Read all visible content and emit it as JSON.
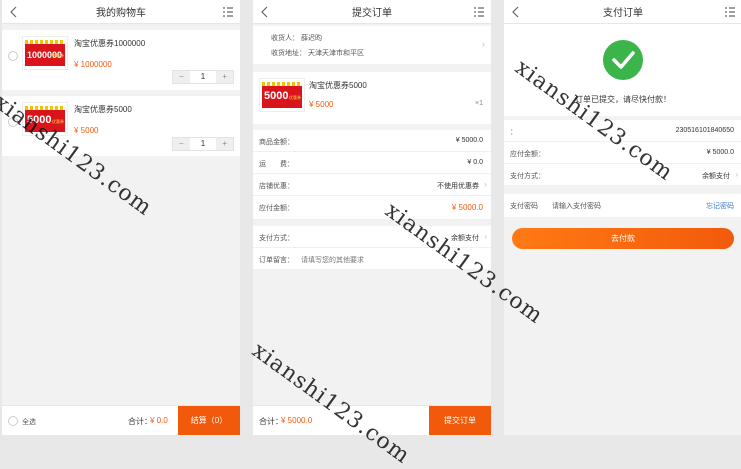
{
  "cart": {
    "title": "我的购物车",
    "items": [
      {
        "name": "淘宝优惠券1000000",
        "price": "¥ 1000000",
        "qty": "1",
        "coupon": "1000000",
        "tag": "优惠券"
      },
      {
        "name": "淘宝优惠券5000",
        "price": "¥ 5000",
        "qty": "1",
        "coupon": "5000",
        "tag": "优惠券"
      }
    ],
    "minus": "−",
    "plus": "+",
    "select_all": "全选",
    "total_label": "合计：",
    "total_value": "¥ 0.0",
    "checkout": "结算（0）"
  },
  "order": {
    "title": "提交订单",
    "receiver": "收货人：  薛迟昀",
    "address": "收货地址：  天津天津市和平区",
    "item_name": "淘宝优惠券5000",
    "item_price": "¥ 5000",
    "item_qty": "×1",
    "coupon": "5000",
    "tag": "优惠券",
    "rows": [
      {
        "k": "商品金额：",
        "v": "¥ 5000.0"
      },
      {
        "k": "运　　费：",
        "v": "¥ 0.0"
      },
      {
        "k": "店铺优惠：",
        "v": "不使用优惠券"
      },
      {
        "k": "应付金额：",
        "v": "¥ 5000.0"
      }
    ],
    "pay_method_label": "支付方式：",
    "pay_method_value": "余额支付",
    "note_label": "订单留言：",
    "note_placeholder": "请填写您的其他要求",
    "total_label": "合计：",
    "total_value": "¥ 5000.0",
    "submit": "提交订单"
  },
  "payment": {
    "title": "支付订单",
    "message": "订单已提交，请尽快付款！",
    "order_no_label": "：",
    "order_no": "230516101840650",
    "amount_label": "应付金额：",
    "amount": "¥ 5000.0",
    "method_label": "支付方式：",
    "method": "余额支付",
    "pwd_label": "支付密码",
    "pwd_placeholder": "请输入支付密码",
    "forgot": "忘记密码",
    "pay": "去付款"
  },
  "watermark": "xianshi123.com",
  "colors": {
    "accent": "#f25a0b",
    "success": "#3bb54a",
    "coupon": "#d9141a"
  }
}
